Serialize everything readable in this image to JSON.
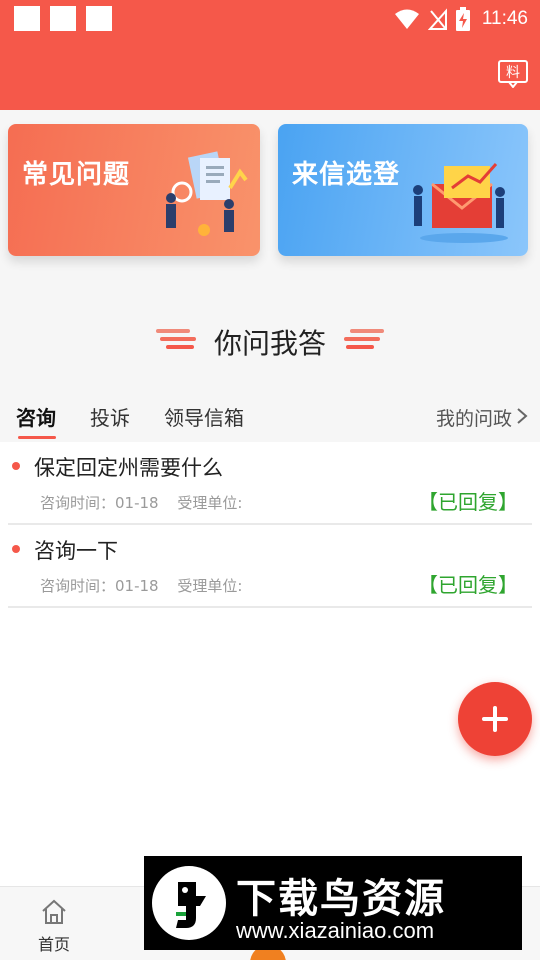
{
  "status_bar": {
    "time": "11:46",
    "icons": [
      "notification-square-icon",
      "notification-square-icon",
      "notification-square-icon",
      "wifi-icon",
      "no-signal-icon",
      "battery-charging-icon"
    ]
  },
  "header": {
    "icon_glyph": "料",
    "icon": "news-board-icon"
  },
  "cards": {
    "faq_title": "常见问题",
    "letter_title": "来信选登"
  },
  "section": {
    "title": "你问我答"
  },
  "tabs": {
    "items": [
      "咨询",
      "投诉",
      "领导信箱"
    ],
    "active_index": 0,
    "my_link": "我的问政"
  },
  "list": {
    "items": [
      {
        "title": "保定回定州需要什么",
        "time_label": "咨询时间：01-18",
        "dept_label": "受理单位:",
        "status": "【已回复】"
      },
      {
        "title": "咨询一下",
        "time_label": "咨询时间：01-18",
        "dept_label": "受理单位:",
        "status": "【已回复】"
      }
    ]
  },
  "fab": {
    "icon": "plus-icon"
  },
  "bottom_nav": {
    "home_label": "首页"
  },
  "watermark": {
    "title": "下载鸟资源",
    "url": "www.xiazainiao.com"
  },
  "colors": {
    "brand_red": "#f5584a",
    "status_green": "#2fa52f",
    "card_orange": "#f56d52",
    "card_blue": "#4aa3f2"
  }
}
